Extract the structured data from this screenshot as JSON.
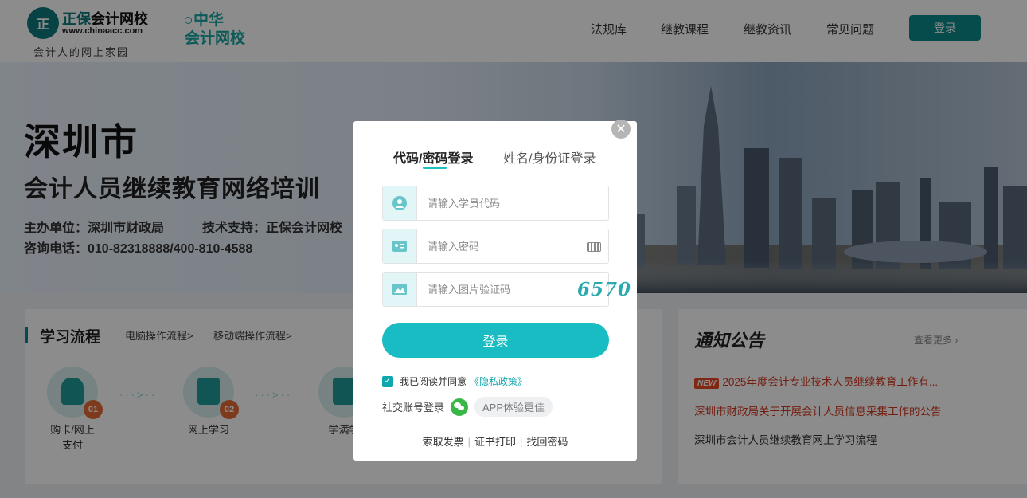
{
  "header": {
    "logo": {
      "circle_text": "正",
      "brand": "正保",
      "name": "会计网校",
      "url": "www.chinaacc.com",
      "slogan": "会计人的网上家园"
    },
    "partner_logo": {
      "line1": "中华",
      "line2": "会计网校"
    },
    "nav": [
      "法规库",
      "继教课程",
      "继教资讯",
      "常见问题"
    ],
    "login_label": "登录"
  },
  "banner": {
    "title": "深圳市",
    "subtitle": "会计人员继续教育网络培训",
    "host": "主办单位：深圳市财政局",
    "support": "技术支持：正保会计网校",
    "phone": "咨询电话：010-82318888/400-810-4588"
  },
  "study": {
    "title": "学习流程",
    "links": [
      "电脑操作流程>",
      "移动端操作流程>"
    ],
    "steps": [
      {
        "num": "01",
        "label": "购卡/网上支付"
      },
      {
        "num": "02",
        "label": "网上学习"
      },
      {
        "num": "03",
        "label": "学满学"
      }
    ],
    "arrow": "···>··"
  },
  "notice": {
    "title": "通知公告",
    "more": "查看更多 ›",
    "new_badge": "NEW",
    "items": [
      "2025年度会计专业技术人员继续教育工作有...",
      "深圳市财政局关于开展会计人员信息采集工作的公告",
      "深圳市会计人员继续教育网上学习流程"
    ]
  },
  "modal": {
    "close": "✕",
    "tabs": [
      "代码/密码登录",
      "姓名/身份证登录"
    ],
    "fields": {
      "code_placeholder": "请输入学员代码",
      "password_placeholder": "请输入密码",
      "captcha_placeholder": "请输入图片验证码"
    },
    "captcha_text": "6570",
    "login_button": "登录",
    "agree_text": "我已阅读并同意",
    "privacy": "《隐私政策》",
    "social_label": "社交账号登录",
    "app_pill": "APP体验更佳",
    "footer_links": [
      "索取发票",
      "证书打印",
      "找回密码"
    ]
  }
}
